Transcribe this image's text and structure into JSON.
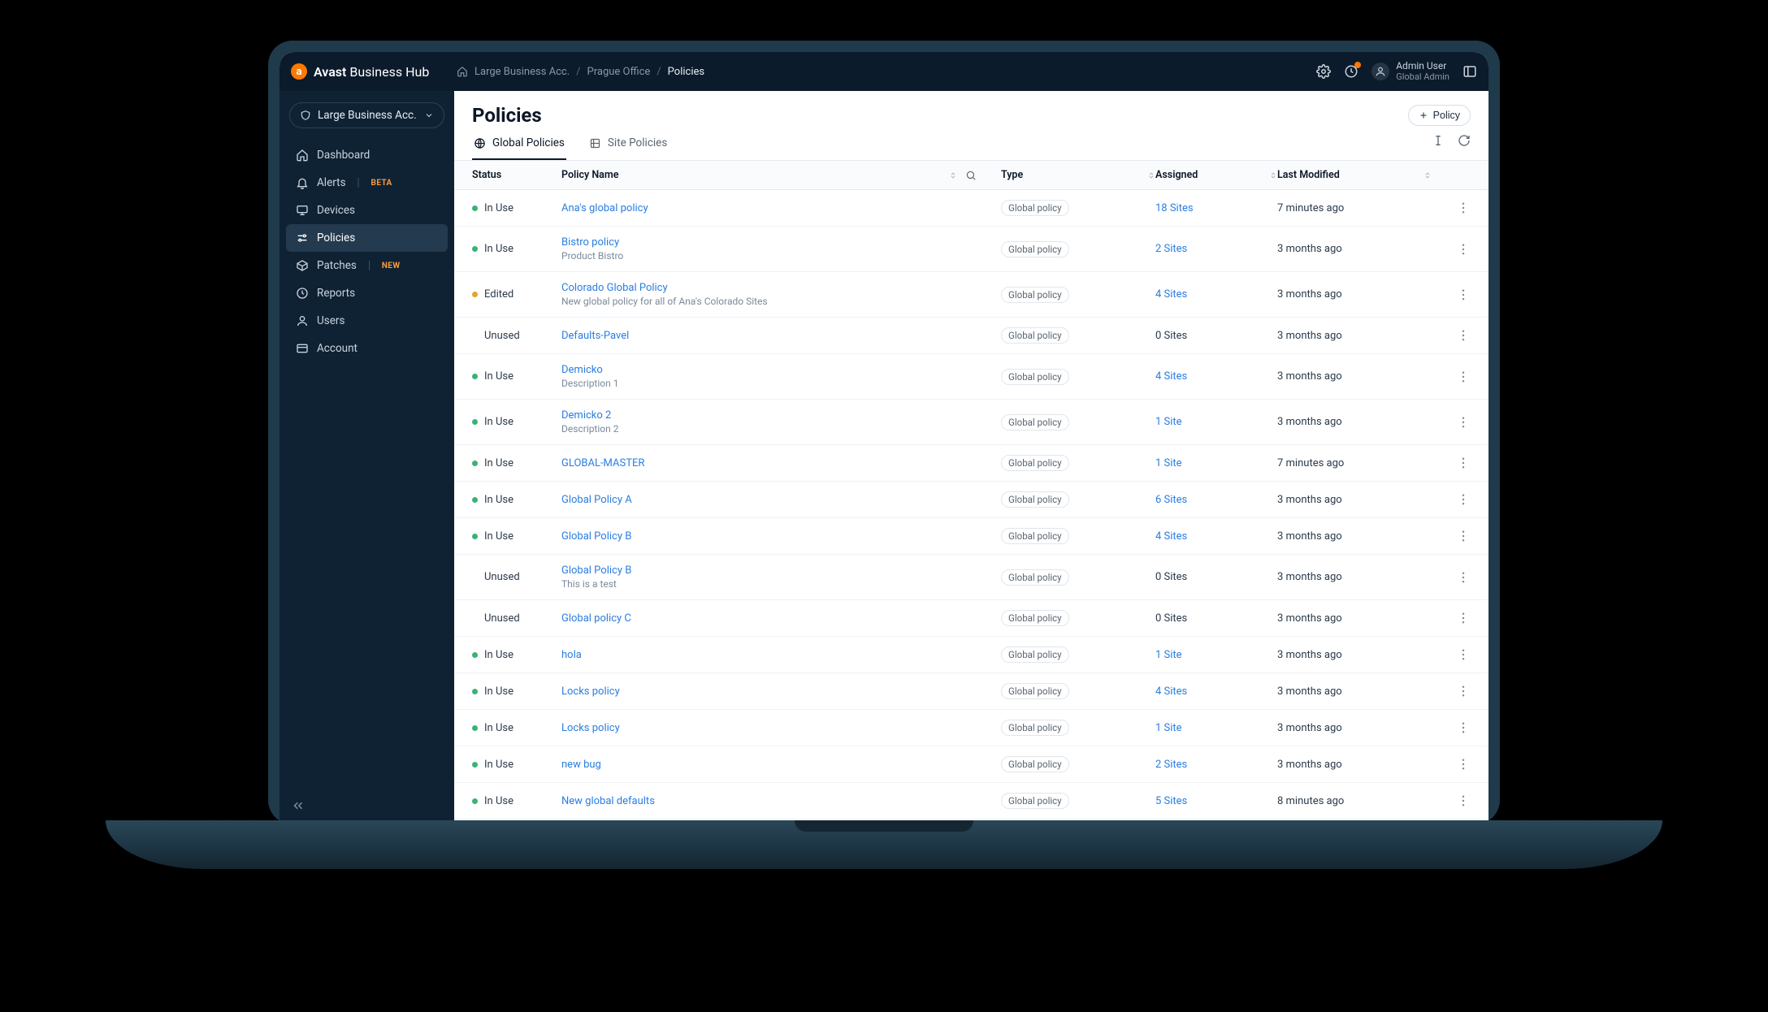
{
  "brand": {
    "name_primary": "Avast",
    "name_secondary": " Business Hub",
    "logo_letter": "a"
  },
  "breadcrumbs": {
    "home_label": "Large Business Acc.",
    "middle_label": "Prague Office",
    "current_label": "Policies"
  },
  "topbar": {
    "user_name": "Admin User",
    "user_role": "Global Admin"
  },
  "sidebar": {
    "account_selector": "Large Business Acc.",
    "items": [
      {
        "icon": "dashboard-icon",
        "label": "Dashboard"
      },
      {
        "icon": "bell-icon",
        "label": "Alerts",
        "badge": "BETA"
      },
      {
        "icon": "monitor-icon",
        "label": "Devices"
      },
      {
        "icon": "sliders-icon",
        "label": "Policies",
        "active": true
      },
      {
        "icon": "package-icon",
        "label": "Patches",
        "badge": "NEW"
      },
      {
        "icon": "clock-icon",
        "label": "Reports"
      },
      {
        "icon": "user-icon",
        "label": "Users"
      },
      {
        "icon": "card-icon",
        "label": "Account"
      }
    ]
  },
  "page": {
    "title": "Policies",
    "new_button": "Policy",
    "tabs": [
      {
        "icon": "globe-icon",
        "label": "Global Policies",
        "active": true
      },
      {
        "icon": "site-icon",
        "label": "Site Policies"
      }
    ]
  },
  "columns": {
    "status": "Status",
    "name": "Policy Name",
    "type": "Type",
    "assigned": "Assigned",
    "last_modified": "Last Modified"
  },
  "rows": [
    {
      "status": "In Use",
      "dot": "green",
      "name": "Ana's global policy",
      "desc": "",
      "type": "Global policy",
      "assigned": "18 Sites",
      "assigned_link": true,
      "last_modified": "7 minutes ago"
    },
    {
      "status": "In Use",
      "dot": "green",
      "name": "Bistro policy",
      "desc": "Product Bistro",
      "type": "Global policy",
      "assigned": "2 Sites",
      "assigned_link": true,
      "last_modified": "3 months ago"
    },
    {
      "status": "Edited",
      "dot": "amber",
      "name": "Colorado Global Policy",
      "desc": "New global policy for all of Ana's Colorado Sites",
      "type": "Global policy",
      "assigned": "4 Sites",
      "assigned_link": true,
      "last_modified": "3 months ago"
    },
    {
      "status": "Unused",
      "dot": "none",
      "name": "Defaults-Pavel",
      "desc": "",
      "type": "Global policy",
      "assigned": "0 Sites",
      "assigned_link": false,
      "last_modified": "3 months ago"
    },
    {
      "status": "In Use",
      "dot": "green",
      "name": "Demicko",
      "desc": "Description 1",
      "type": "Global policy",
      "assigned": "4 Sites",
      "assigned_link": true,
      "last_modified": "3 months ago"
    },
    {
      "status": "In Use",
      "dot": "green",
      "name": "Demicko 2",
      "desc": "Description 2",
      "type": "Global policy",
      "assigned": "1 Site",
      "assigned_link": true,
      "last_modified": "3 months ago"
    },
    {
      "status": "In Use",
      "dot": "green",
      "name": "GLOBAL-MASTER",
      "desc": "",
      "type": "Global policy",
      "assigned": "1 Site",
      "assigned_link": true,
      "last_modified": "7 minutes ago"
    },
    {
      "status": "In Use",
      "dot": "green",
      "name": "Global Policy A",
      "desc": "",
      "type": "Global policy",
      "assigned": "6 Sites",
      "assigned_link": true,
      "last_modified": "3 months ago"
    },
    {
      "status": "In Use",
      "dot": "green",
      "name": "Global Policy B",
      "desc": "",
      "type": "Global policy",
      "assigned": "4 Sites",
      "assigned_link": true,
      "last_modified": "3 months ago"
    },
    {
      "status": "Unused",
      "dot": "none",
      "name": "Global Policy B",
      "desc": "This is a test",
      "type": "Global policy",
      "assigned": "0 Sites",
      "assigned_link": false,
      "last_modified": "3 months ago"
    },
    {
      "status": "Unused",
      "dot": "none",
      "name": "Global policy C",
      "desc": "",
      "type": "Global policy",
      "assigned": "0 Sites",
      "assigned_link": false,
      "last_modified": "3 months ago"
    },
    {
      "status": "In Use",
      "dot": "green",
      "name": "hola",
      "desc": "",
      "type": "Global policy",
      "assigned": "1 Site",
      "assigned_link": true,
      "last_modified": "3 months ago"
    },
    {
      "status": "In Use",
      "dot": "green",
      "name": "Locks policy",
      "desc": "",
      "type": "Global policy",
      "assigned": "4 Sites",
      "assigned_link": true,
      "last_modified": "3 months ago"
    },
    {
      "status": "In Use",
      "dot": "green",
      "name": "Locks policy",
      "desc": "",
      "type": "Global policy",
      "assigned": "1 Site",
      "assigned_link": true,
      "last_modified": "3 months ago"
    },
    {
      "status": "In Use",
      "dot": "green",
      "name": "new bug",
      "desc": "",
      "type": "Global policy",
      "assigned": "2 Sites",
      "assigned_link": true,
      "last_modified": "3 months ago"
    },
    {
      "status": "In Use",
      "dot": "green",
      "name": "New global defaults",
      "desc": "",
      "type": "Global policy",
      "assigned": "5 Sites",
      "assigned_link": true,
      "last_modified": "8 minutes ago"
    }
  ]
}
